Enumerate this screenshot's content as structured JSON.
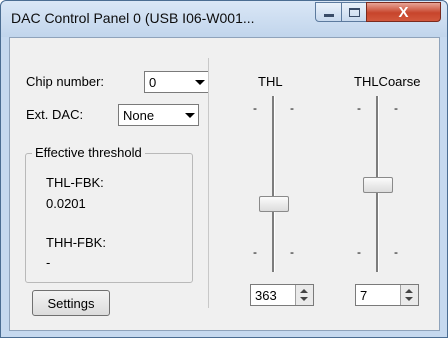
{
  "window": {
    "title": "DAC Control Panel 0 (USB I06-W001...",
    "close_glyph": "X"
  },
  "chip": {
    "label": "Chip number:",
    "value": "0"
  },
  "ext_dac": {
    "label": "Ext. DAC:",
    "value": "None"
  },
  "threshold": {
    "legend": "Effective threshold",
    "thl_fbk_label": "THL-FBK:",
    "thl_fbk_value": "0.0201",
    "thh_fbk_label": "THH-FBK:",
    "thh_fbk_value": "-"
  },
  "settings_label": "Settings",
  "sliders": [
    {
      "label": "THL",
      "tick": "-",
      "value": "363"
    },
    {
      "label": "THLCoarse",
      "tick": "-",
      "value": "7"
    }
  ]
}
